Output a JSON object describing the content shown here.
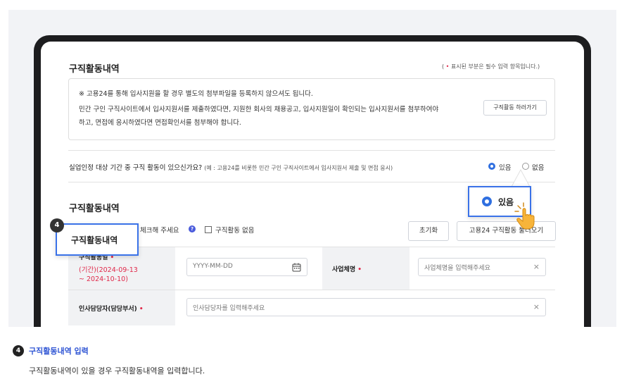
{
  "header": {
    "title": "구직활동내역",
    "required_note_prefix": "(",
    "required_dot": "•",
    "required_note": "표시된 부분은 필수 입력 항목입니다.)"
  },
  "notice": {
    "line1": "※ 고용24를 통해 입사지원을 할 경우 별도의 첨부파일을 등록하지 않으셔도 됩니다.",
    "line2": "민간 구인 구직사이트에서 입사지원서를 제출하였다면, 지원한 회사의 채용공고, 입사지원일이 확인되는 입사지원서를 첨부하여야",
    "line3": "하고, 면접에 응시하였다면 면접확인서를 첨부해야 합니다.",
    "button_label": "구직활동 하러가기"
  },
  "question": {
    "text": "실업인정 대상 기간 중 구직 활동이 있으신가요?",
    "sub": "(예 : 고용24를 비롯한 민간 구인 구직사이트에서 입사지원서 제출 및 면접 응시)",
    "options": [
      "있음",
      "없음"
    ],
    "selected": "있음"
  },
  "callout_yes": {
    "label": "있음"
  },
  "section": {
    "title": "구직활동내역",
    "check_hint": "체크해 주세요",
    "no_activity_label": "구직활동 없음",
    "reset_button": "초기화",
    "load_button": "고용24 구직활동 불러오기"
  },
  "callout_section": {
    "badge": "4",
    "label": "구직활동내역"
  },
  "form": {
    "date_label": "구직활동일",
    "period_line1": "(기간)(2024-09-13",
    "period_line2": "~ 2024-10-10)",
    "date_placeholder": "YYYY-MM-DD",
    "business_label": "사업체명",
    "business_placeholder": "사업체명을 입력해주세요",
    "hr_label": "인사담당자(담당부서)",
    "hr_placeholder": "인사담당자를 입력해주세요",
    "clear_symbol": "×",
    "required_star": "•"
  },
  "footer": {
    "badge": "4",
    "title": "구직활동내역 입력",
    "description": "구직활동내역이 있을 경우 구직활동내역을 입력합니다."
  },
  "colors": {
    "accent": "#3a72e8",
    "required": "#e0294a",
    "footer_title": "#2f55d4"
  },
  "icons": [
    "calendar-icon",
    "clear-icon",
    "info-icon",
    "hand-pointer-icon"
  ]
}
